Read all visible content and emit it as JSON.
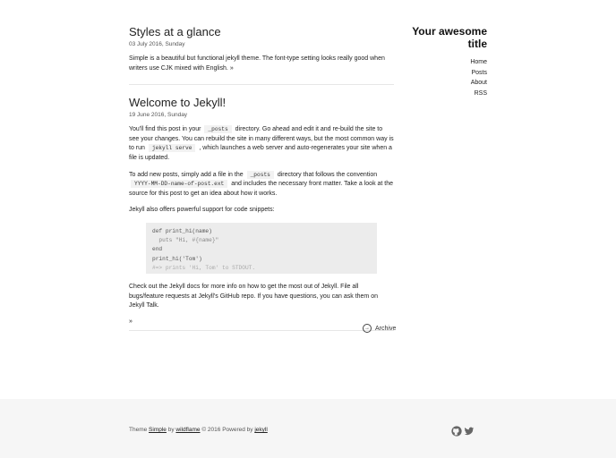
{
  "sidebar": {
    "title_line1": "Your awesome",
    "title_line2": "title",
    "nav": [
      "Home",
      "Posts",
      "About",
      "RSS"
    ]
  },
  "posts": [
    {
      "title": "Styles at a glance",
      "date": "03 July 2016, Sunday",
      "excerpt": "Simple is a beautiful but functional jekyll theme. The font-type setting looks really good when writers use CJK mixed with English. »"
    },
    {
      "title": "Welcome to Jekyll!",
      "date": "19 June 2016, Sunday",
      "p1_a": "You'll find this post in your",
      "p1_code1": "_posts",
      "p1_b": "directory. Go ahead and edit it and re-build the site to see your changes. You can rebuild the site in many different ways, but the most common way is to run",
      "p1_code2": "jekyll serve",
      "p1_c": ", which launches a web server and auto-regenerates your site when a file is updated.",
      "p2_a": "To add new posts, simply add a file in the",
      "p2_code1": "_posts",
      "p2_b": "directory that follows the convention",
      "p2_code2": "YYYY-MM-DD-name-of-post.ext",
      "p2_c": "and includes the necessary front matter. Take a look at the source for this post to get an idea about how it works.",
      "p3": "Jekyll also offers powerful support for code snippets:",
      "code_lines": [
        "def print_hi(name)",
        "  puts \"Hi, #{name}\"",
        "end",
        "print_hi('Tom')",
        "#=> prints 'Hi, Tom' to STDOUT."
      ],
      "p4": "Check out the Jekyll docs for more info on how to get the most out of Jekyll. File all bugs/feature requests at Jekyll's GitHub repo. If you have questions, you can ask them on Jekyll Talk.",
      "more": "»"
    }
  ],
  "archive_label": "Archive",
  "footer": {
    "theme": "Theme",
    "simple": "Simple",
    "by": "by",
    "author": "wildflame",
    "copy": "© 2016 Powered by",
    "jekyll": "jekyll"
  },
  "icons": [
    "github-icon",
    "twitter-icon"
  ]
}
